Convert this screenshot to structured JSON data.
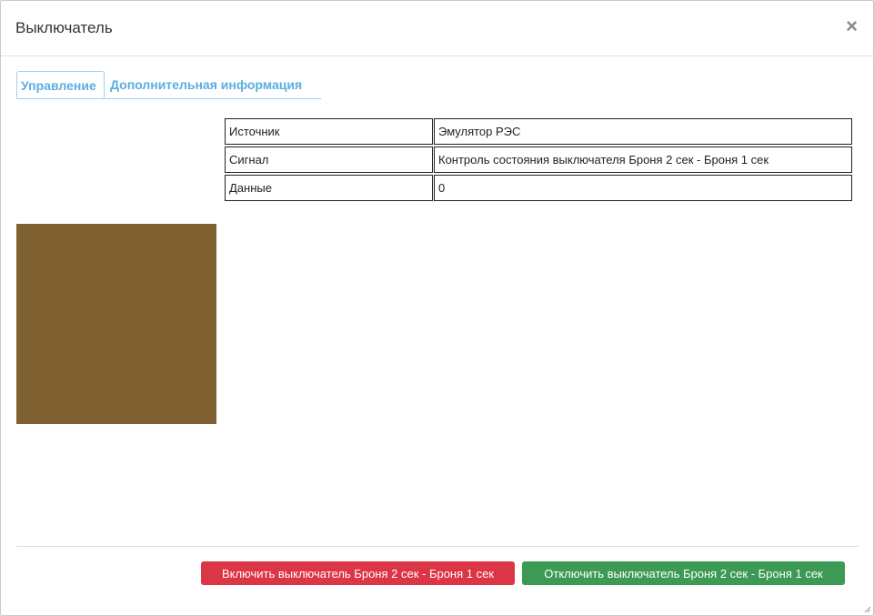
{
  "dialog": {
    "title": "Выключатель",
    "close_glyph": "×"
  },
  "tabs": [
    {
      "label": "Управление",
      "active": true
    },
    {
      "label": "Дополнительная информация",
      "active": false
    }
  ],
  "info_table": {
    "rows": [
      {
        "key": "Источник",
        "value": "Эмулятор РЭС"
      },
      {
        "key": "Сигнал",
        "value": "Контроль состояния выключателя Броня 2 сек - Броня 1 сек"
      },
      {
        "key": "Данные",
        "value": "0"
      }
    ]
  },
  "state_indicator": {
    "color": "#7f6131"
  },
  "buttons": {
    "on_label": "Включить выключатель Броня 2 сек - Броня 1 сек",
    "on_color": "#dc3545",
    "off_label": "Отключить выключатель Броня 2 сек - Броня 1 сек",
    "off_color": "#3c9a54"
  }
}
